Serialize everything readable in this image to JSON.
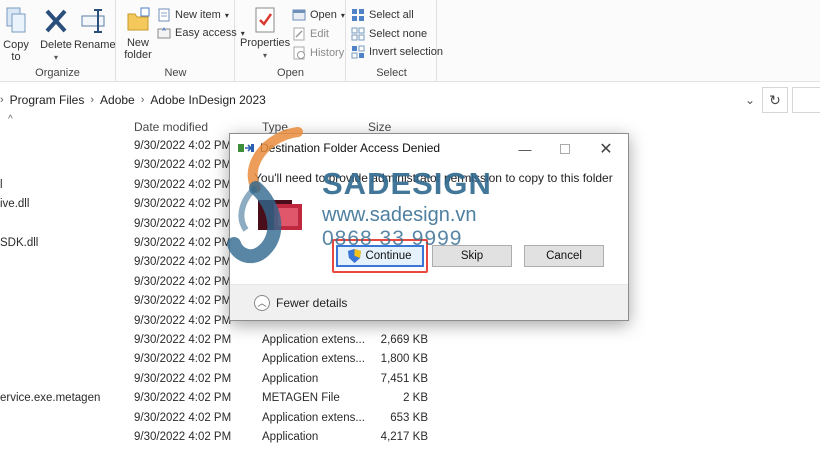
{
  "ribbon": {
    "organize": {
      "label": "Organize",
      "copy_to": "Copy to",
      "delete": "Delete",
      "rename": "Rename"
    },
    "new": {
      "label": "New",
      "new_folder": "New folder",
      "new_item": "New item",
      "easy_access": "Easy access"
    },
    "open": {
      "label": "Open",
      "properties": "Properties",
      "open": "Open",
      "edit": "Edit",
      "history": "History"
    },
    "select": {
      "label": "Select",
      "select_all": "Select all",
      "select_none": "Select none",
      "invert_selection": "Invert selection"
    }
  },
  "address": {
    "crumbs": [
      "Program Files",
      "Adobe",
      "Adobe InDesign 2023"
    ]
  },
  "columns": {
    "date": "Date modified",
    "type": "Type",
    "size": "Size"
  },
  "rows": [
    {
      "name": "",
      "date": "9/30/2022 4:02 PM",
      "type": "",
      "size": ""
    },
    {
      "name": "",
      "date": "9/30/2022 4:02 PM",
      "type": "",
      "size": ""
    },
    {
      "name": "l",
      "date": "9/30/2022 4:02 PM",
      "type": "",
      "size": ""
    },
    {
      "name": "ive.dll",
      "date": "9/30/2022 4:02 PM",
      "type": "",
      "size": ""
    },
    {
      "name": "",
      "date": "9/30/2022 4:02 PM",
      "type": "",
      "size": ""
    },
    {
      "name": "SDK.dll",
      "date": "9/30/2022 4:02 PM",
      "type": "",
      "size": ""
    },
    {
      "name": "",
      "date": "9/30/2022 4:02 PM",
      "type": "",
      "size": ""
    },
    {
      "name": "",
      "date": "9/30/2022 4:02 PM",
      "type": "",
      "size": ""
    },
    {
      "name": "",
      "date": "9/30/2022 4:02 PM",
      "type": "",
      "size": ""
    },
    {
      "name": "",
      "date": "9/30/2022 4:02 PM",
      "type": "",
      "size": ""
    },
    {
      "name": "",
      "date": "9/30/2022 4:02 PM",
      "type": "Application extens...",
      "size": "2,669 KB"
    },
    {
      "name": "",
      "date": "9/30/2022 4:02 PM",
      "type": "Application extens...",
      "size": "1,800 KB"
    },
    {
      "name": "",
      "date": "9/30/2022 4:02 PM",
      "type": "Application",
      "size": "7,451 KB"
    },
    {
      "name": "ervice.exe.metagen",
      "date": "9/30/2022 4:02 PM",
      "type": "METAGEN File",
      "size": "2 KB"
    },
    {
      "name": "",
      "date": "9/30/2022 4:02 PM",
      "type": "Application extens...",
      "size": "653 KB"
    },
    {
      "name": "",
      "date": "9/30/2022 4:02 PM",
      "type": "Application",
      "size": "4,217 KB"
    }
  ],
  "dialog": {
    "title": "Destination Folder Access Denied",
    "message": "You'll need to provide administrator permission to copy to this folder",
    "continue": "Continue",
    "skip": "Skip",
    "cancel": "Cancel",
    "fewer_details": "Fewer details"
  },
  "watermark": {
    "brand": "SADESIGN",
    "website": "www.sadesign.vn",
    "phone": "0868 33 9999"
  }
}
